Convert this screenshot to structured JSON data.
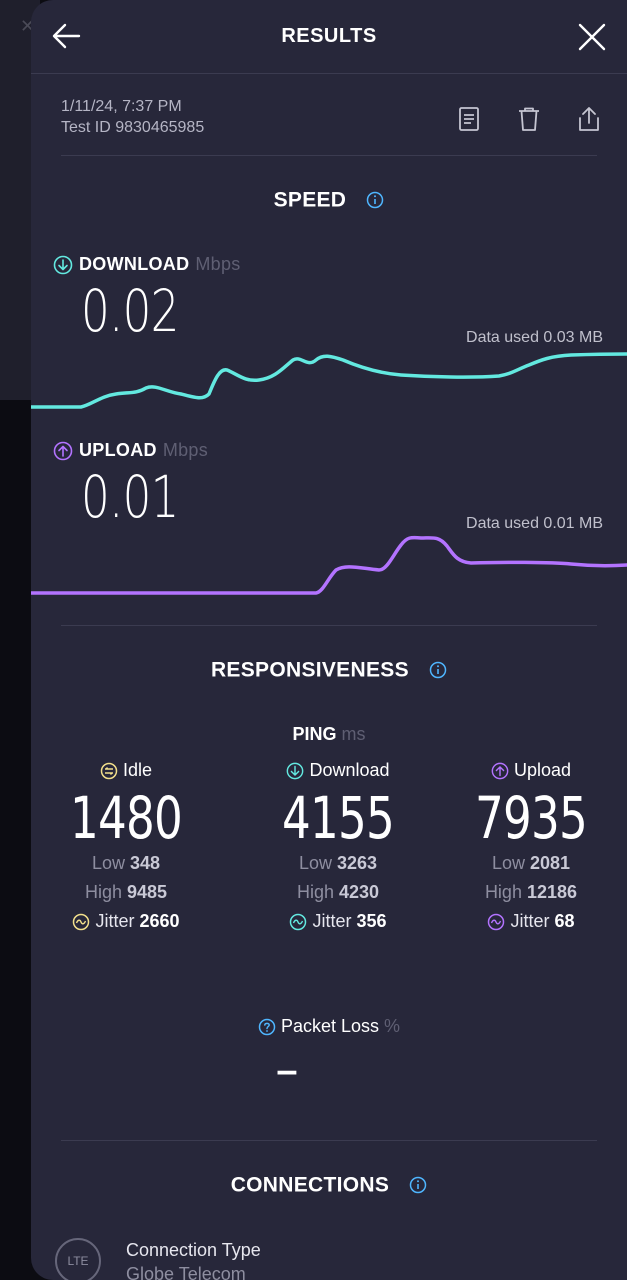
{
  "header": {
    "title": "RESULTS"
  },
  "meta": {
    "date": "1/11/24, 7:37 PM",
    "test_id": "Test ID 9830465985"
  },
  "speed": {
    "title": "SPEED",
    "download": {
      "label": "DOWNLOAD",
      "unit": "Mbps",
      "value": "0.02",
      "data_used": "Data used 0.03 MB"
    },
    "upload": {
      "label": "UPLOAD",
      "unit": "Mbps",
      "value": "0.01",
      "data_used": "Data used 0.01 MB"
    }
  },
  "responsiveness": {
    "title": "RESPONSIVENESS",
    "ping_label": "PING",
    "ping_unit": "ms",
    "columns": [
      {
        "label": "Idle",
        "value": "1480",
        "low_label": "Low",
        "low": "348",
        "high_label": "High",
        "high": "9485",
        "jitter_label": "Jitter",
        "jitter": "2660"
      },
      {
        "label": "Download",
        "value": "4155",
        "low_label": "Low",
        "low": "3263",
        "high_label": "High",
        "high": "4230",
        "jitter_label": "Jitter",
        "jitter": "356"
      },
      {
        "label": "Upload",
        "value": "7935",
        "low_label": "Low",
        "low": "2081",
        "high_label": "High",
        "high": "12186",
        "jitter_label": "Jitter",
        "jitter": "68"
      }
    ],
    "packet_loss": {
      "label": "Packet Loss",
      "unit": "%",
      "value": "–"
    }
  },
  "connections": {
    "title": "CONNECTIONS",
    "badge": "LTE",
    "type_label": "Connection Type",
    "provider": "Globe Telecom"
  },
  "colors": {
    "download": "#63e9e0",
    "upload": "#b373ff",
    "idle": "#f3e08c",
    "background": "#27273a"
  }
}
